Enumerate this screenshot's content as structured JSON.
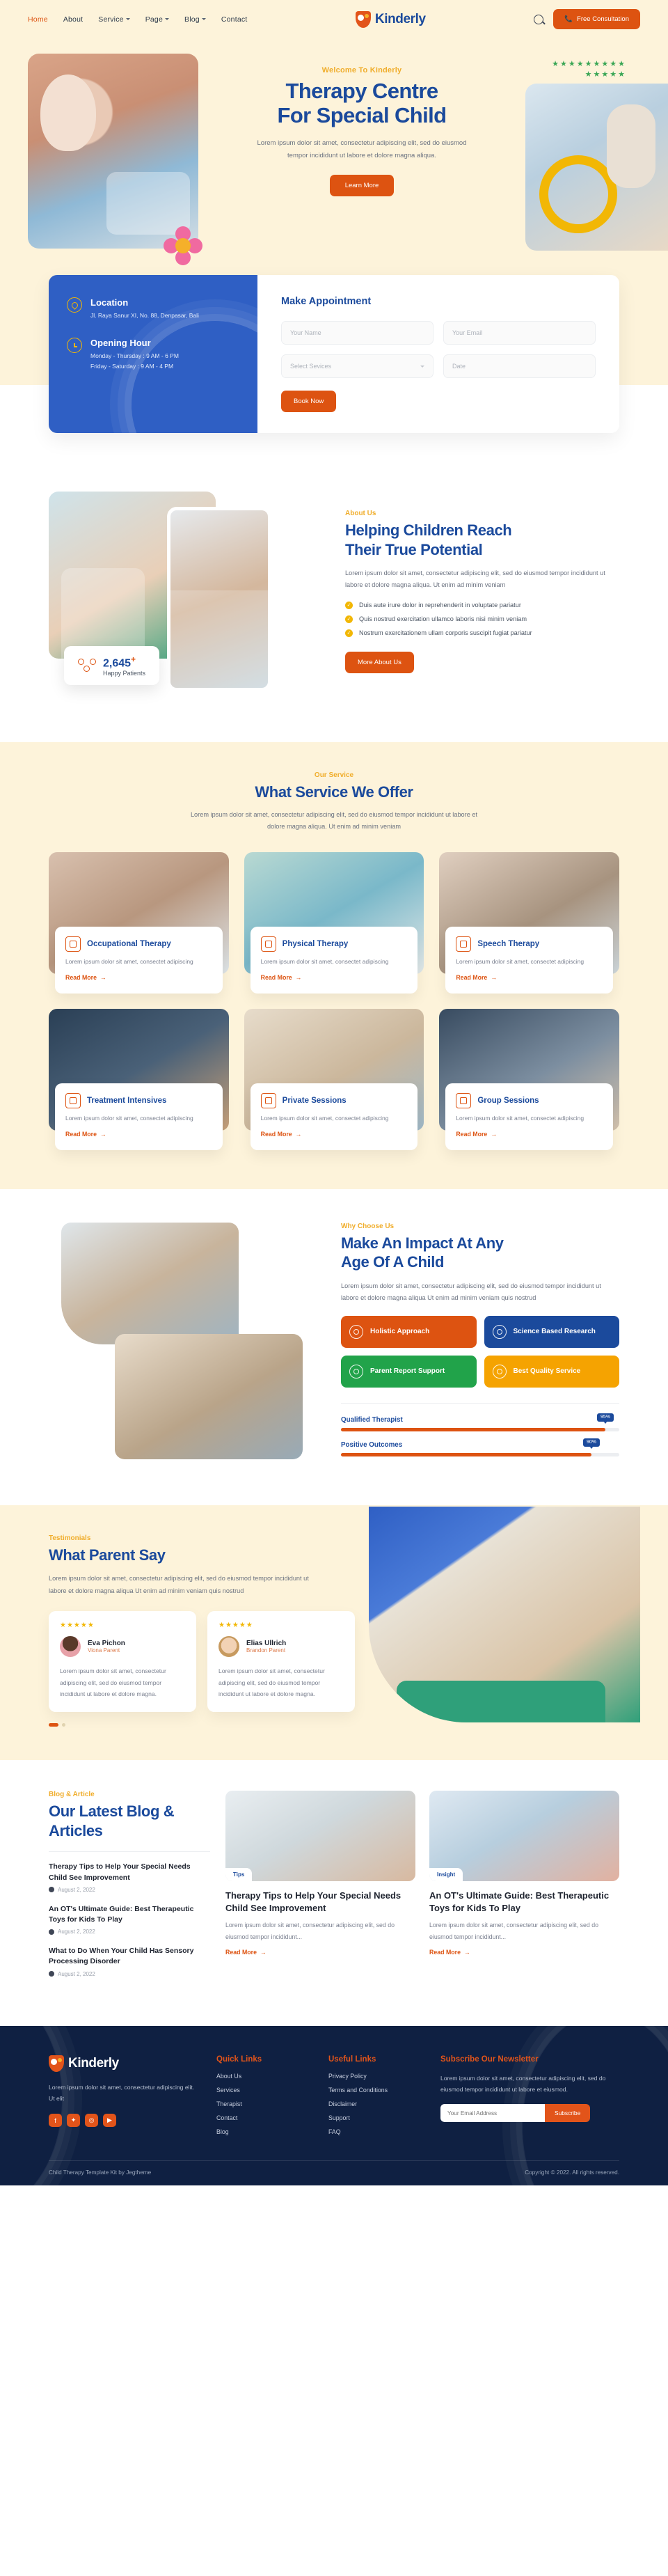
{
  "brand": {
    "name": "Kinderly",
    "icon": "shield-star-icon"
  },
  "header": {
    "nav": [
      {
        "label": "Home",
        "active": true
      },
      {
        "label": "About",
        "active": false
      },
      {
        "label": "Service",
        "caret": true
      },
      {
        "label": "Page",
        "caret": true
      },
      {
        "label": "Blog",
        "caret": true
      },
      {
        "label": "Contact",
        "active": false
      }
    ],
    "search_icon": "search-icon",
    "cta": {
      "label": "Free Consultation",
      "icon": "phone-icon",
      "color": "#dd5311"
    }
  },
  "hero": {
    "eyebrow": "Welcome To Kinderly",
    "title_line1": "Therapy Centre",
    "title_line2": "For Special Child",
    "body": "Lorem ipsum dolor sit amet, consectetur adipiscing elit, sed do eiusmod tempor incididunt ut labore et dolore magna aliqua.",
    "cta": "Learn More"
  },
  "appointment": {
    "location": {
      "icon": "location-pin-icon",
      "title": "Location",
      "value": "Jl. Raya Sanur XI, No. 88, Denpasar, Bali"
    },
    "hours": {
      "icon": "clock-icon",
      "title": "Opening Hour",
      "line1": "Monday - Thursday : 9 AM - 6 PM",
      "line2": "Friday - Saturday : 9 AM - 4 PM"
    },
    "form_title": "Make Appointment",
    "fields": {
      "name_placeholder": "Your Name",
      "email_placeholder": "Your Email",
      "service_placeholder": "Select Sevices",
      "date_placeholder": "Date"
    },
    "submit": "Book Now"
  },
  "about": {
    "eyebrow": "About Us",
    "title_line1": "Helping Children Reach",
    "title_line2": "Their True Potential",
    "body": "Lorem ipsum dolor sit amet, consectetur adipiscing elit, sed do eiusmod tempor incididunt ut labore et dolore magna aliqua. Ut enim ad minim veniam",
    "checks": [
      "Duis aute irure dolor in reprehenderit in voluptate pariatur",
      "Quis nostrud exercitation ullamco laboris nisi minim veniam",
      "Nostrum exercitationem ullam corporis suscipit fugiat pariatur"
    ],
    "cta": "More About Us",
    "stat": {
      "icon": "happy-patients-icon",
      "number": "2,645",
      "plus": "+",
      "label": "Happy Patients"
    }
  },
  "services": {
    "eyebrow": "Our Service",
    "title": "What Service We Offer",
    "body": "Lorem ipsum dolor sit amet, consectetur adipiscing elit, sed do eiusmod tempor incididunt ut labore et dolore magna aliqua. Ut enim ad minim veniam",
    "read_more": "Read More",
    "cards": [
      {
        "icon": "puzzle-icon",
        "title": "Occupational Therapy",
        "desc": "Lorem ipsum dolor sit amet, consectet adipiscing"
      },
      {
        "icon": "stethoscope-icon",
        "title": "Physical Therapy",
        "desc": "Lorem ipsum dolor sit amet, consectet adipiscing"
      },
      {
        "icon": "abc-blocks-icon",
        "title": "Speech Therapy",
        "desc": "Lorem ipsum dolor sit amet, consectet adipiscing"
      },
      {
        "icon": "blocks-icon",
        "title": "Treatment Intensives",
        "desc": "Lorem ipsum dolor sit amet, consectet adipiscing"
      },
      {
        "icon": "rocking-horse-icon",
        "title": "Private Sessions",
        "desc": "Lorem ipsum dolor sit amet, consectet adipiscing"
      },
      {
        "icon": "train-icon",
        "title": "Group Sessions",
        "desc": "Lorem ipsum dolor sit amet, consectet adipiscing"
      }
    ]
  },
  "why": {
    "eyebrow": "Why Choose Us",
    "title_line1": "Make An Impact At Any",
    "title_line2": "Age Of A Child",
    "body": "Lorem ipsum dolor sit amet, consectetur adipiscing elit, sed do eiusmod tempor incididunt ut labore et dolore magna aliqua Ut enim ad minim veniam quis nostrud",
    "boxes": [
      {
        "icon": "target-icon",
        "label": "Holistic Approach",
        "color": "#dd5311"
      },
      {
        "icon": "microscope-icon",
        "label": "Science Based Research",
        "color": "#1b4a9c"
      },
      {
        "icon": "parents-icon",
        "label": "Parent Report Support",
        "color": "#21a34a"
      },
      {
        "icon": "badge-thumb-icon",
        "label": "Best Quality Service",
        "color": "#f5a301"
      }
    ],
    "bars": [
      {
        "label": "Qualified Therapist",
        "value": 95,
        "display": "95%"
      },
      {
        "label": "Positive Outcomes",
        "value": 90,
        "display": "90%"
      }
    ]
  },
  "testimonials": {
    "eyebrow": "Testimonials",
    "title": "What Parent Say",
    "body": "Lorem ipsum dolor sit amet, consectetur adipiscing elit, sed do eiusmod tempor incididunt ut labore et dolore magna aliqua Ut enim ad minim veniam quis nostrud",
    "cards": [
      {
        "stars": "★★★★★",
        "avatar": "avatar-eva",
        "name": "Eva Pichon",
        "role": "Viona Parent",
        "quote": "Lorem ipsum dolor sit amet, consectetur adipiscing elit, sed do eiusmod tempor incididunt ut labore et dolore magna."
      },
      {
        "stars": "★★★★★",
        "avatar": "avatar-elias",
        "name": "Elias Ullrich",
        "role": "Brandon Parent",
        "quote": "Lorem ipsum dolor sit amet, consectetur adipiscing elit, sed do eiusmod tempor incididunt ut labore et dolore magna."
      }
    ]
  },
  "blog": {
    "eyebrow": "Blog & Article",
    "title_line1": "Our Latest Blog &",
    "title_line2": "Articles",
    "list": [
      {
        "title": "Therapy Tips to Help Your Special Needs Child See Improvement",
        "date": "August 2, 2022",
        "icon": "clock-icon"
      },
      {
        "title": "An OT's Ultimate Guide: Best Therapeutic Toys for Kids To Play",
        "date": "August 2, 2022",
        "icon": "clock-icon"
      },
      {
        "title": "What to Do When Your Child Has Sensory Processing Disorder",
        "date": "August 2, 2022",
        "icon": "clock-icon"
      }
    ],
    "read_more": "Read More",
    "cards": [
      {
        "tag": "Tips",
        "title": "Therapy Tips to Help Your Special Needs Child See Improvement",
        "desc": "Lorem ipsum dolor sit amet, consectetur adipiscing elit, sed do eiusmod tempor incididunt..."
      },
      {
        "tag": "Insight",
        "title": "An OT's Ultimate Guide: Best Therapeutic Toys for Kids To Play",
        "desc": "Lorem ipsum dolor sit amet, consectetur adipiscing elit, sed do eiusmod tempor incididunt..."
      }
    ]
  },
  "footer": {
    "desc": "Lorem ipsum dolor sit amet, consectetur adipiscing elit. Ut elit",
    "socials": [
      {
        "icon": "facebook-icon",
        "glyph": "f"
      },
      {
        "icon": "twitter-icon",
        "glyph": "✦"
      },
      {
        "icon": "instagram-icon",
        "glyph": "◎"
      },
      {
        "icon": "youtube-icon",
        "glyph": "▶"
      }
    ],
    "quick": {
      "heading": "Quick Links",
      "items": [
        "About Us",
        "Services",
        "Therapist",
        "Contact",
        "Blog"
      ]
    },
    "useful": {
      "heading": "Useful Links",
      "items": [
        "Privacy Policy",
        "Terms and Conditions",
        "Disclaimer",
        "Support",
        "FAQ"
      ]
    },
    "newsletter": {
      "heading": "Subscribe Our Newsletter",
      "desc": "Lorem ipsum dolor sit amet, consectetur adipiscing elit, sed do eiusmod tempor incididunt ut labore et eiusmod.",
      "placeholder": "Your Email Address",
      "button": "Subscribe"
    },
    "credit": "Child Therapy Template Kit by Jegtheme",
    "copyright": "Copyright © 2022. All rights reserved."
  }
}
